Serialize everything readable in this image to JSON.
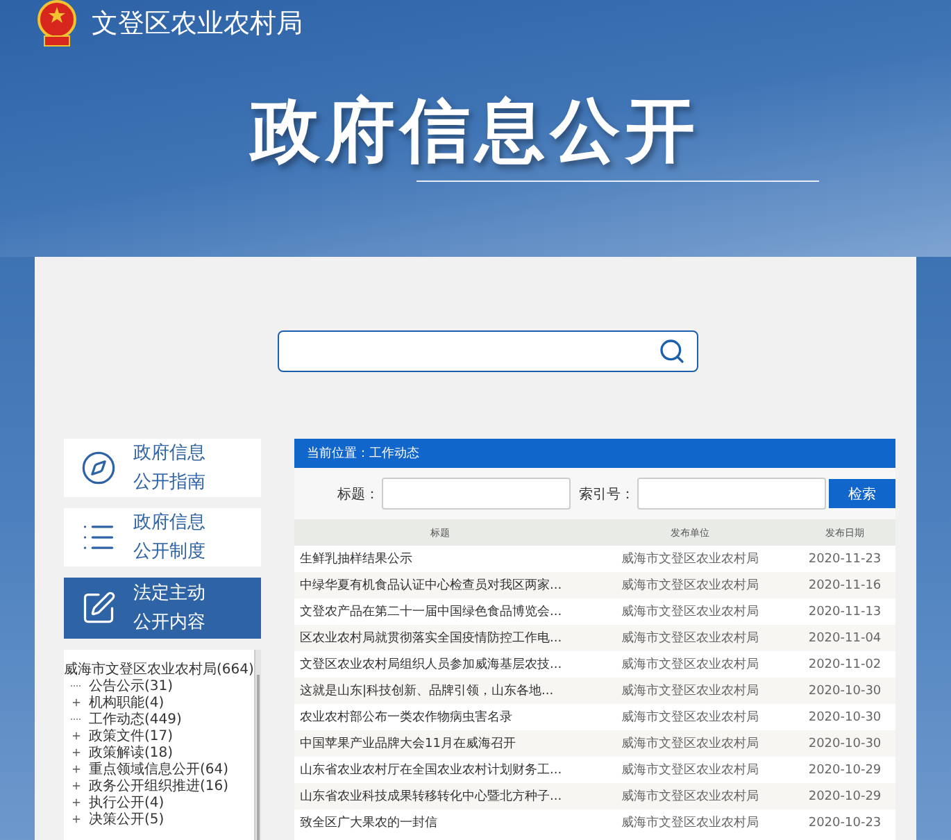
{
  "header": {
    "agency": "文登区农业农村局",
    "title": "政府信息公开"
  },
  "sidebar": {
    "items": [
      {
        "kind": "guide",
        "line1": "政府信息",
        "line2": "公开指南",
        "selected": false
      },
      {
        "kind": "rules",
        "line1": "政府信息",
        "line2": "公开制度",
        "selected": false
      },
      {
        "kind": "content",
        "line1": "法定主动",
        "line2": "公开内容",
        "selected": true
      }
    ]
  },
  "tree": {
    "root": "威海市文登区农业农村局(664)",
    "children": [
      {
        "label": "公告公示(31)",
        "kind": "leaf"
      },
      {
        "label": "机构职能(4)",
        "kind": "folder"
      },
      {
        "label": "工作动态(449)",
        "kind": "leaf"
      },
      {
        "label": "政策文件(17)",
        "kind": "folder"
      },
      {
        "label": "政策解读(18)",
        "kind": "folder"
      },
      {
        "label": "重点领域信息公开(64)",
        "kind": "folder"
      },
      {
        "label": "政务公开组织推进(16)",
        "kind": "folder"
      },
      {
        "label": "执行公开(4)",
        "kind": "folder"
      },
      {
        "label": "决策公开(5)",
        "kind": "folder"
      }
    ]
  },
  "content": {
    "breadcrumb": "当前位置：工作动态",
    "filter": {
      "title_label": "标题：",
      "index_label": "索引号：",
      "button": "检索"
    },
    "columns": [
      "标题",
      "发布单位",
      "发布日期"
    ],
    "rows": [
      {
        "title": "生鲜乳抽样结果公示",
        "unit": "威海市文登区农业农村局",
        "date": "2020-11-23"
      },
      {
        "title": "中绿华夏有机食品认证中心检查员对我区两家...",
        "unit": "威海市文登区农业农村局",
        "date": "2020-11-16"
      },
      {
        "title": "文登农产品在第二十一届中国绿色食品博览会...",
        "unit": "威海市文登区农业农村局",
        "date": "2020-11-13"
      },
      {
        "title": "区农业农村局就贯彻落实全国疫情防控工作电...",
        "unit": "威海市文登区农业农村局",
        "date": "2020-11-04"
      },
      {
        "title": "文登区农业农村局组织人员参加威海基层农技...",
        "unit": "威海市文登区农业农村局",
        "date": "2020-11-02"
      },
      {
        "title": "这就是山东|科技创新、品牌引领，山东各地...",
        "unit": "威海市文登区农业农村局",
        "date": "2020-10-30"
      },
      {
        "title": "农业农村部公布一类农作物病虫害名录",
        "unit": "威海市文登区农业农村局",
        "date": "2020-10-30"
      },
      {
        "title": "中国苹果产业品牌大会11月在威海召开",
        "unit": "威海市文登区农业农村局",
        "date": "2020-10-30"
      },
      {
        "title": "山东省农业农村厅在全国农业农村计划财务工...",
        "unit": "威海市文登区农业农村局",
        "date": "2020-10-29"
      },
      {
        "title": "山东省农业科技成果转移转化中心暨北方种子...",
        "unit": "威海市文登区农业农村局",
        "date": "2020-10-29"
      },
      {
        "title": "致全区广大果农的一封信",
        "unit": "威海市文登区农业农村局",
        "date": "2020-10-23"
      }
    ]
  }
}
